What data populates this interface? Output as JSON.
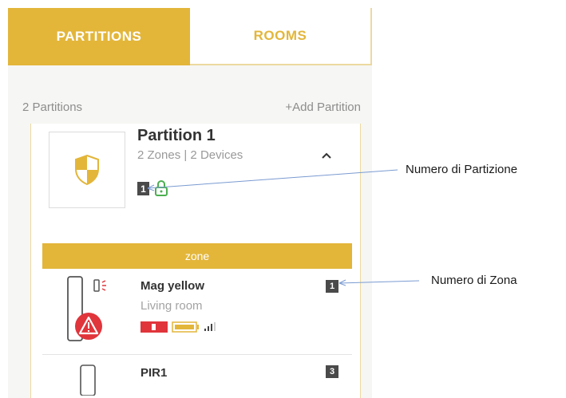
{
  "tabs": [
    {
      "label": "PARTITIONS",
      "active": true
    },
    {
      "label": "ROOMS",
      "active": false
    }
  ],
  "header": {
    "partitions_count": "2 Partitions",
    "add_partition": "+Add Partition"
  },
  "partition": {
    "title": "Partition 1",
    "subtitle": "2 Zones | 2 Devices",
    "number": "1",
    "icon": "shield-icon",
    "lock_icon": "lock-icon"
  },
  "zone_header": "zone",
  "zones": [
    {
      "name": "Mag yellow",
      "room": "Living room",
      "number": "1",
      "icon": "door-contact-sensor-icon",
      "alert_icon": "warning-icon"
    },
    {
      "name": "PIR1",
      "room": "",
      "number": "3",
      "icon": "pir-sensor-icon"
    }
  ],
  "annotations": {
    "partition_number": "Numero di Partizione",
    "zone_number": "Numero di Zona"
  },
  "colors": {
    "accent": "#e3b63a",
    "alert": "#e0353b",
    "lock": "#4caf50",
    "badge": "#4a4a4a"
  }
}
